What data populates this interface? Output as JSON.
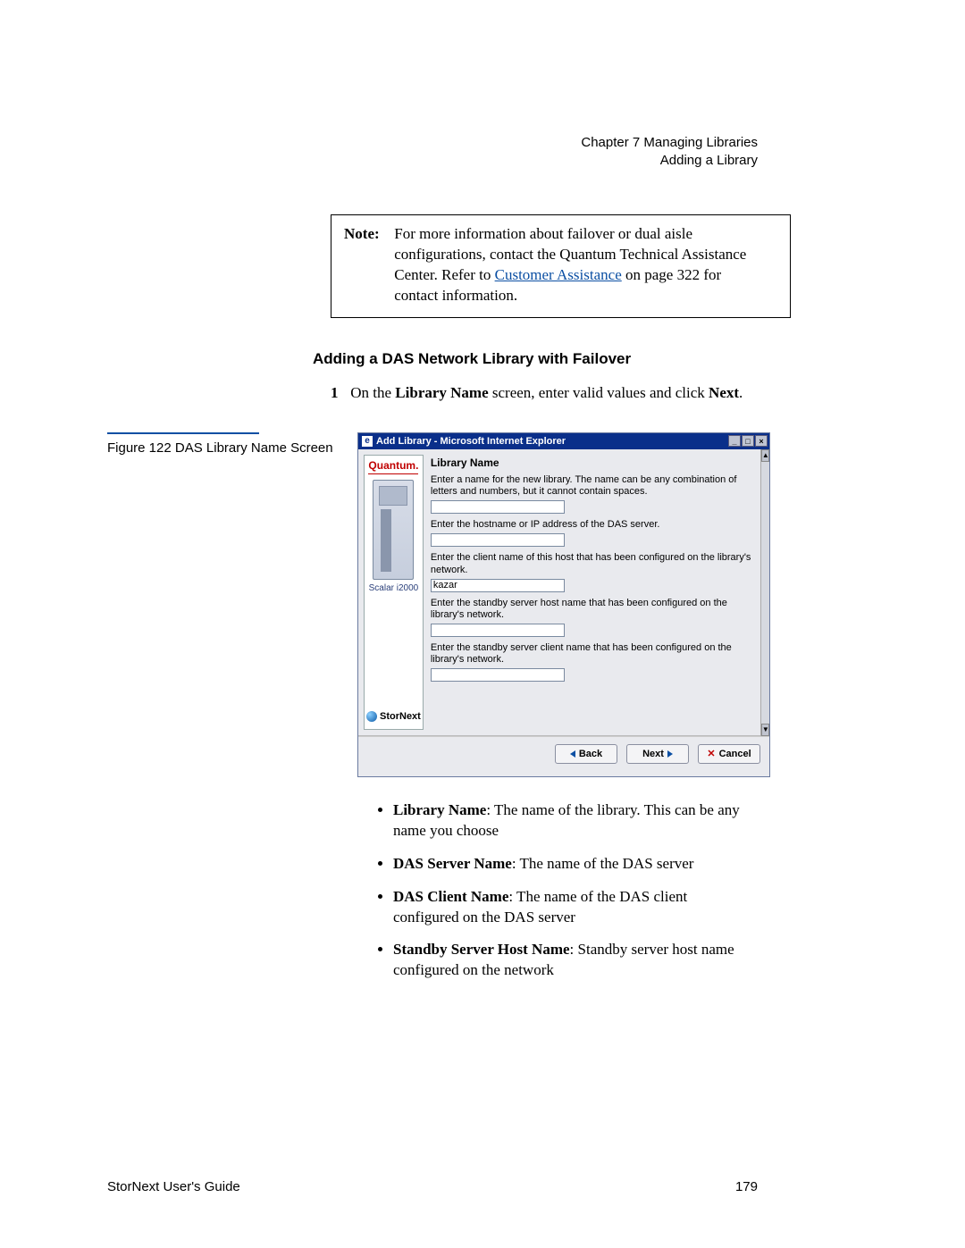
{
  "header": {
    "chapter": "Chapter 7  Managing Libraries",
    "section": "Adding a Library"
  },
  "note": {
    "label": "Note:",
    "before_link": "For more information about failover or dual aisle configurations, contact the Quantum Technical Assistance Center. Refer to ",
    "link_text": "Customer Assistance",
    "after_link": " on page  322 for contact information."
  },
  "heading": "Adding a DAS Network Library with Failover",
  "step": {
    "num": "1",
    "before_bold1": "On the ",
    "bold1": "Library Name",
    "mid": " screen, enter valid values and click ",
    "bold2": "Next",
    "after": "."
  },
  "figure": {
    "caption": "Figure 122  DAS Library Name Screen"
  },
  "screenshot": {
    "title": "Add Library - Microsoft Internet Explorer",
    "sidebar": {
      "brand": "Quantum.",
      "model": "Scalar i2000",
      "product": "StorNext"
    },
    "panel_title": "Library Name",
    "desc1": "Enter a name for the new library. The name can be any combination of letters and numbers, but it cannot contain spaces.",
    "val1": "",
    "desc2": "Enter the hostname or IP address of the DAS server.",
    "val2": "",
    "desc3": "Enter the client name of this host that has been configured on the library's network.",
    "val3": "kazar",
    "desc4": "Enter the standby server host name that has been configured on the library's network.",
    "val4": "",
    "desc5": "Enter the standby server client name that has been configured on the library's network.",
    "val5": "",
    "buttons": {
      "back": "Back",
      "next": "Next",
      "cancel": "Cancel"
    }
  },
  "bullets": [
    {
      "term": "Library Name",
      "text": ": The name of the library. This can be any name you choose"
    },
    {
      "term": "DAS Server Name",
      "text": ": The name of the DAS server"
    },
    {
      "term": "DAS Client Name",
      "text": ": The name of the DAS client configured on the DAS server"
    },
    {
      "term": "Standby Server Host Name",
      "text": ": Standby server host name configured on the network"
    }
  ],
  "footer": {
    "left": "StorNext User's Guide",
    "right": "179"
  }
}
